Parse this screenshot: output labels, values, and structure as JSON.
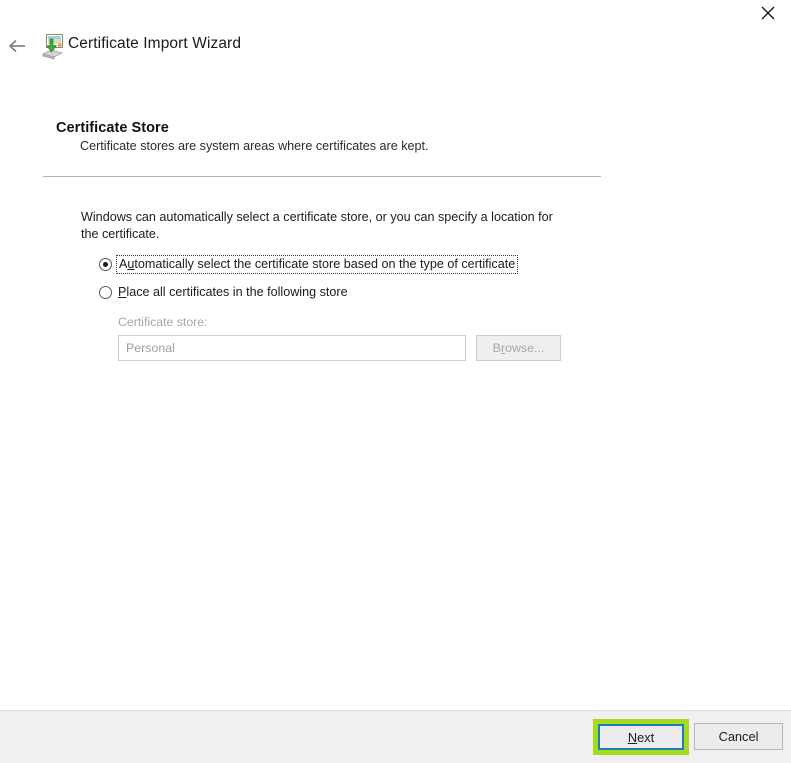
{
  "window": {
    "close_icon": "close-icon"
  },
  "header": {
    "back_icon": "back-arrow-icon",
    "wizard_icon": "certificate-import-icon",
    "title": "Certificate Import Wizard"
  },
  "page": {
    "title": "Certificate Store",
    "subtitle": "Certificate stores are system areas where certificates are kept.",
    "intro": "Windows can automatically select a certificate store, or you can specify a location for the certificate."
  },
  "options": {
    "auto": {
      "label_before": "A",
      "accel": "u",
      "label_after": "tomatically select the certificate store based on the type of certificate",
      "selected": true,
      "focused": true
    },
    "manual": {
      "accel": "P",
      "label_after": "lace all certificates in the following store",
      "selected": false,
      "focused": false
    }
  },
  "store_field": {
    "label": "Certificate store:",
    "value": "Personal",
    "placeholder": "",
    "disabled": true,
    "browse": {
      "label_before": "B",
      "accel": "r",
      "label_after": "owse...",
      "disabled": true
    }
  },
  "footer": {
    "next": {
      "label_before": "",
      "accel": "N",
      "label_after": "ext",
      "focused": true,
      "highlight_color": "#a7d91c",
      "focus_border_color": "#1a7fb5"
    },
    "cancel": {
      "label": "Cancel"
    }
  }
}
